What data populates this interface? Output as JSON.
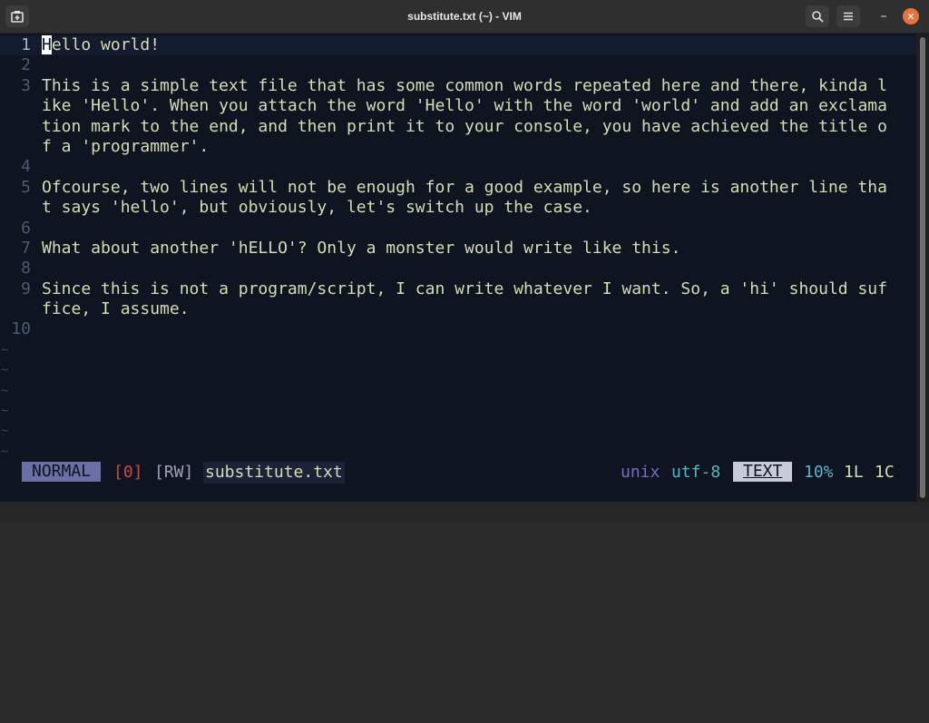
{
  "window": {
    "title": "substitute.txt (~) - VIM",
    "minimize_glyph": "–",
    "close_glyph": "✕"
  },
  "editor": {
    "lines": [
      {
        "num": "1",
        "text": "Hello world!",
        "cursor_char": "H"
      },
      {
        "num": "2",
        "text": ""
      },
      {
        "num": "3",
        "text": "This is a simple text file that has some common words repeated here and there, kinda l"
      },
      {
        "num": "",
        "text": "ike 'Hello'. When you attach the word 'Hello' with the word 'world' and add an exclama"
      },
      {
        "num": "",
        "text": "tion mark to the end, and then print it to your console, you have achieved the title o"
      },
      {
        "num": "",
        "text": "f a 'programmer'."
      },
      {
        "num": "4",
        "text": ""
      },
      {
        "num": "5",
        "text": "Ofcourse, two lines will not be enough for a good example, so here is another line tha"
      },
      {
        "num": "",
        "text": "t says 'hello', but obviously, let's switch up the case."
      },
      {
        "num": "6",
        "text": ""
      },
      {
        "num": "7",
        "text": "What about another 'hELLO'? Only a monster would write like this."
      },
      {
        "num": "8",
        "text": ""
      },
      {
        "num": "9",
        "text": "Since this is not a program/script, I can write whatever I want. So, a 'hi' should suf"
      },
      {
        "num": "",
        "text": "fice, I assume."
      },
      {
        "num": "10",
        "text": ""
      }
    ],
    "tilde": "~"
  },
  "status": {
    "mode": "NORMAL",
    "buffer": "[0]",
    "rw": "[RW]",
    "filename": "substitute.txt",
    "fileformat": "unix",
    "encoding": "utf-8",
    "filetype": "TEXT",
    "percent": "10%",
    "line": "1L",
    "column": "1C"
  },
  "icons": {
    "new_tab": "new-tab-icon",
    "search": "search-icon",
    "menu": "hamburger-menu-icon",
    "minimize": "minimize-icon",
    "close": "close-icon"
  },
  "colors": {
    "background": "#0e1420",
    "text": "#d6dcb6",
    "mode_bg": "#6a6fa6",
    "close_button": "#e5733d"
  }
}
